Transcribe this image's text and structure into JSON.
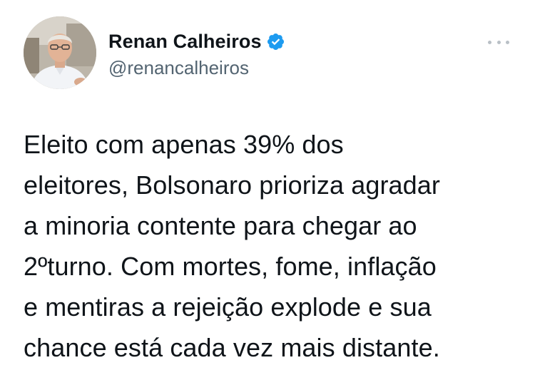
{
  "author": {
    "display_name": "Renan Calheiros",
    "handle": "@renancalheiros",
    "verified": true,
    "avatar_icon": "profile-photo"
  },
  "tweet": {
    "text": "Eleito com apenas 39% dos\neleitores, Bolsonaro prioriza agradar\na minoria contente para chegar ao\n2ºturno. Com mortes, fome, inflação\ne mentiras a rejeição explode e sua\nchance está cada vez mais distante."
  },
  "icons": {
    "verified": "verified-badge-icon",
    "more": "more-options-icon"
  },
  "colors": {
    "verified_badge": "#1d9bf0",
    "text_primary": "#0f1419",
    "text_secondary": "#536471"
  }
}
